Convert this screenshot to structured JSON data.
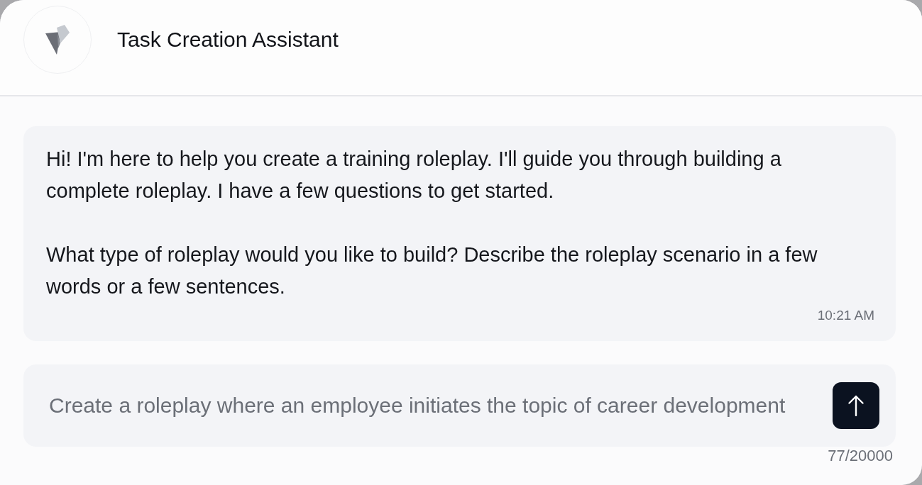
{
  "header": {
    "title": "Task Creation Assistant"
  },
  "messages": [
    {
      "paragraphs": [
        "Hi! I'm here to help you create a training roleplay. I'll guide you through building a complete roleplay. I have a few questions to get started.",
        "What type of roleplay would you like to build? Describe the roleplay scenario in a few words or a few sentences."
      ],
      "time": "10:21 AM"
    }
  ],
  "composer": {
    "value": "Create a roleplay where an employee initiates the topic of career development",
    "counter": "77/20000"
  }
}
